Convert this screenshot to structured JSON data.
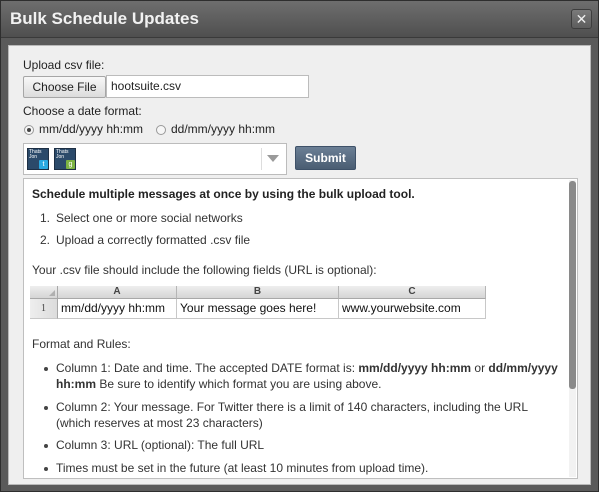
{
  "dialog": {
    "title": "Bulk Schedule Updates",
    "close_icon": "close-icon"
  },
  "upload": {
    "label": "Upload csv file:",
    "choose_button": "Choose File",
    "file_name": "hootsuite.csv"
  },
  "date_format": {
    "label": "Choose a date format:",
    "options": [
      {
        "label": "mm/dd/yyyy hh:mm",
        "selected": true
      },
      {
        "label": "dd/mm/yyyy hh:mm",
        "selected": false
      }
    ]
  },
  "profiles": {
    "avatars": [
      {
        "text": "Thats Jon",
        "icon": "twitter-icon",
        "badge_color": "#29a9e1"
      },
      {
        "text": "Thats Jon",
        "icon": "google-plus-icon",
        "badge_color": "#7cb342"
      }
    ],
    "dropdown_icon": "chevron-down-icon"
  },
  "submit_label": "Submit",
  "instructions": {
    "heading": "Schedule multiple messages at once by using the bulk upload tool.",
    "steps": [
      "Select one or more social networks",
      "Upload a correctly formatted .csv file"
    ],
    "fields_intro": "Your .csv file should include the following fields (URL is optional):",
    "sheet": {
      "columns": [
        "A",
        "B",
        "C"
      ],
      "row_number": "1",
      "row": [
        "mm/dd/yyyy hh:mm",
        "Your message goes here!",
        "www.yourwebsite.com"
      ]
    },
    "rules_title": "Format and Rules:",
    "rules": {
      "col1_prefix": "Column 1: Date and time. The accepted DATE format is: ",
      "col1_fmt1": "mm/dd/yyyy hh:mm",
      "col1_or": " or ",
      "col1_fmt2": "dd/mm/yyyy",
      "col1_fmt2b": "hh:mm",
      "col1_suffix": " Be sure to identify which format you are using above.",
      "col2_line1": "Column 2: Your message. For Twitter there is a limit of 140 characters, including the URL",
      "col2_line2": "(which reserves at most 23 characters)",
      "col3": "Column 3: URL (optional): The full URL",
      "future": "Times must be set in the future (at least 10 minutes from upload time)."
    }
  }
}
